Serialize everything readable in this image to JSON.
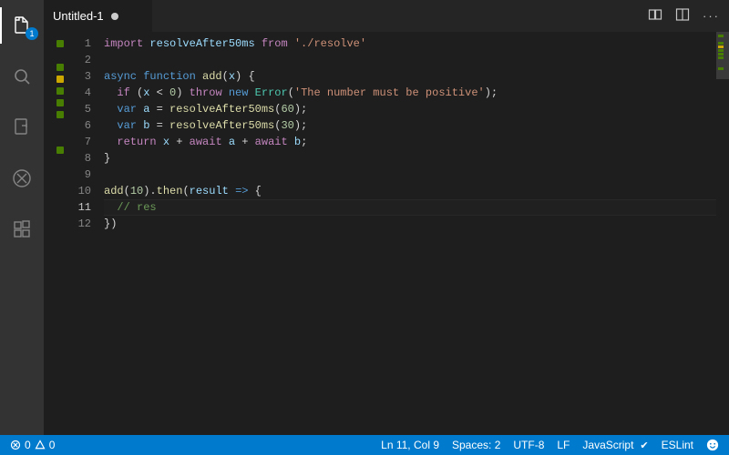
{
  "tab": {
    "title": "Untitled-1",
    "dirty": true
  },
  "explorer_badge": "1",
  "code": {
    "lines": [
      {
        "n": 1,
        "mark": "green",
        "tokens": [
          [
            "kw",
            "import"
          ],
          [
            "pn",
            " "
          ],
          [
            "id",
            "resolveAfter50ms"
          ],
          [
            "pn",
            " "
          ],
          [
            "kw",
            "from"
          ],
          [
            "pn",
            " "
          ],
          [
            "str",
            "'./resolve'"
          ]
        ]
      },
      {
        "n": 2,
        "mark": "",
        "tokens": []
      },
      {
        "n": 3,
        "mark": "green",
        "tokens": [
          [
            "kw2",
            "async"
          ],
          [
            "pn",
            " "
          ],
          [
            "kw2",
            "function"
          ],
          [
            "pn",
            " "
          ],
          [
            "fn",
            "add"
          ],
          [
            "pn",
            "("
          ],
          [
            "id",
            "x"
          ],
          [
            "pn",
            ") {"
          ]
        ]
      },
      {
        "n": 4,
        "mark": "yellow",
        "tokens": [
          [
            "pn",
            "  "
          ],
          [
            "kw",
            "if"
          ],
          [
            "pn",
            " ("
          ],
          [
            "id",
            "x"
          ],
          [
            "pn",
            " < "
          ],
          [
            "num",
            "0"
          ],
          [
            "pn",
            ") "
          ],
          [
            "kw",
            "throw"
          ],
          [
            "pn",
            " "
          ],
          [
            "kw2",
            "new"
          ],
          [
            "pn",
            " "
          ],
          [
            "cls",
            "Error"
          ],
          [
            "pn",
            "("
          ],
          [
            "str",
            "'The number must be positive'"
          ],
          [
            "pn",
            ");"
          ]
        ]
      },
      {
        "n": 5,
        "mark": "green",
        "tokens": [
          [
            "pn",
            "  "
          ],
          [
            "kw2",
            "var"
          ],
          [
            "pn",
            " "
          ],
          [
            "id",
            "a"
          ],
          [
            "pn",
            " = "
          ],
          [
            "fn",
            "resolveAfter50ms"
          ],
          [
            "pn",
            "("
          ],
          [
            "num",
            "60"
          ],
          [
            "pn",
            ");"
          ]
        ]
      },
      {
        "n": 6,
        "mark": "green",
        "tokens": [
          [
            "pn",
            "  "
          ],
          [
            "kw2",
            "var"
          ],
          [
            "pn",
            " "
          ],
          [
            "id",
            "b"
          ],
          [
            "pn",
            " = "
          ],
          [
            "fn",
            "resolveAfter50ms"
          ],
          [
            "pn",
            "("
          ],
          [
            "num",
            "30"
          ],
          [
            "pn",
            ");"
          ]
        ]
      },
      {
        "n": 7,
        "mark": "green",
        "tokens": [
          [
            "pn",
            "  "
          ],
          [
            "kw",
            "return"
          ],
          [
            "pn",
            " "
          ],
          [
            "id",
            "x"
          ],
          [
            "pn",
            " + "
          ],
          [
            "kw",
            "await"
          ],
          [
            "pn",
            " "
          ],
          [
            "id",
            "a"
          ],
          [
            "pn",
            " + "
          ],
          [
            "kw",
            "await"
          ],
          [
            "pn",
            " "
          ],
          [
            "id",
            "b"
          ],
          [
            "pn",
            ";"
          ]
        ]
      },
      {
        "n": 8,
        "mark": "",
        "tokens": [
          [
            "pn",
            "}"
          ]
        ]
      },
      {
        "n": 9,
        "mark": "",
        "tokens": []
      },
      {
        "n": 10,
        "mark": "green",
        "tokens": [
          [
            "fn",
            "add"
          ],
          [
            "pn",
            "("
          ],
          [
            "num",
            "10"
          ],
          [
            "pn",
            ")."
          ],
          [
            "fn",
            "then"
          ],
          [
            "pn",
            "("
          ],
          [
            "id",
            "result"
          ],
          [
            "pn",
            " "
          ],
          [
            "kw2",
            "=>"
          ],
          [
            "pn",
            " {"
          ]
        ]
      },
      {
        "n": 11,
        "mark": "",
        "active": true,
        "tokens": [
          [
            "pn",
            "  "
          ],
          [
            "cm",
            "// res"
          ]
        ]
      },
      {
        "n": 12,
        "mark": "",
        "tokens": [
          [
            "pn",
            "})"
          ]
        ]
      }
    ]
  },
  "status": {
    "errors": "0",
    "warnings": "0",
    "cursor": "Ln 11, Col 9",
    "spaces": "Spaces: 2",
    "encoding": "UTF-8",
    "eol": "LF",
    "language": "JavaScript",
    "eslint": "ESLint"
  }
}
